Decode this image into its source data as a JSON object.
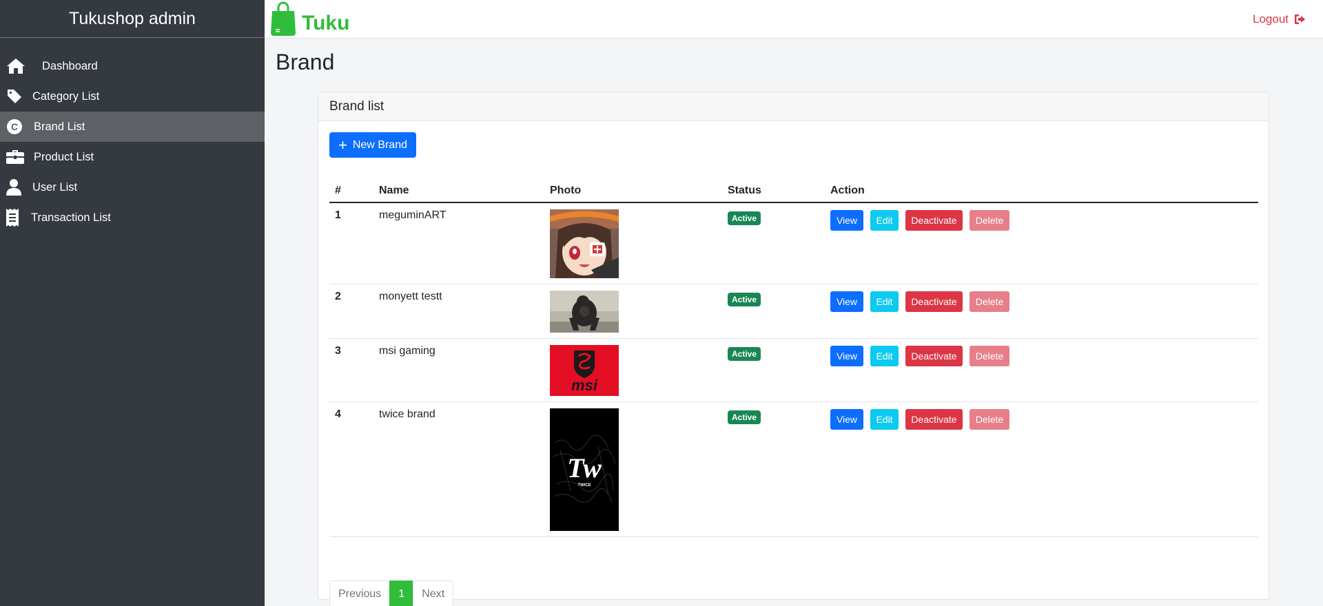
{
  "sidebar": {
    "title": "Tukushop admin",
    "items": [
      {
        "label": "Dashboard",
        "icon": "home-icon"
      },
      {
        "label": "Category List",
        "icon": "tag-icon"
      },
      {
        "label": "Brand List",
        "icon": "copyright-icon",
        "active": true
      },
      {
        "label": "Product List",
        "icon": "briefcase-icon"
      },
      {
        "label": "User List",
        "icon": "user-icon"
      },
      {
        "label": "Transaction List",
        "icon": "receipt-icon"
      }
    ]
  },
  "topbar": {
    "brand": "Tuku",
    "logout_label": "Logout"
  },
  "page": {
    "title": "Brand"
  },
  "card": {
    "header": "Brand list",
    "new_button": "New Brand",
    "columns": [
      "#",
      "Name",
      "Photo",
      "Status",
      "Action"
    ],
    "rows": [
      {
        "num": "1",
        "name": "meguminART",
        "status": "Active",
        "photo": "anime character portrait"
      },
      {
        "num": "2",
        "name": "monyett testt",
        "status": "Active",
        "photo": "gorilla photo"
      },
      {
        "num": "3",
        "name": "msi gaming",
        "status": "Active",
        "photo": "msi logo"
      },
      {
        "num": "4",
        "name": "twice brand",
        "status": "Active",
        "photo": "twice logo"
      }
    ],
    "actions": {
      "view": "View",
      "edit": "Edit",
      "deactivate": "Deactivate",
      "delete": "Delete"
    }
  },
  "pagination": {
    "previous": "Previous",
    "current": "1",
    "next": "Next"
  },
  "colors": {
    "sidebar_bg": "#343a40",
    "brand_green": "#2fbd3b",
    "primary": "#0d6efd",
    "info": "#0dcaf0",
    "danger": "#dc3545",
    "success": "#198754"
  }
}
